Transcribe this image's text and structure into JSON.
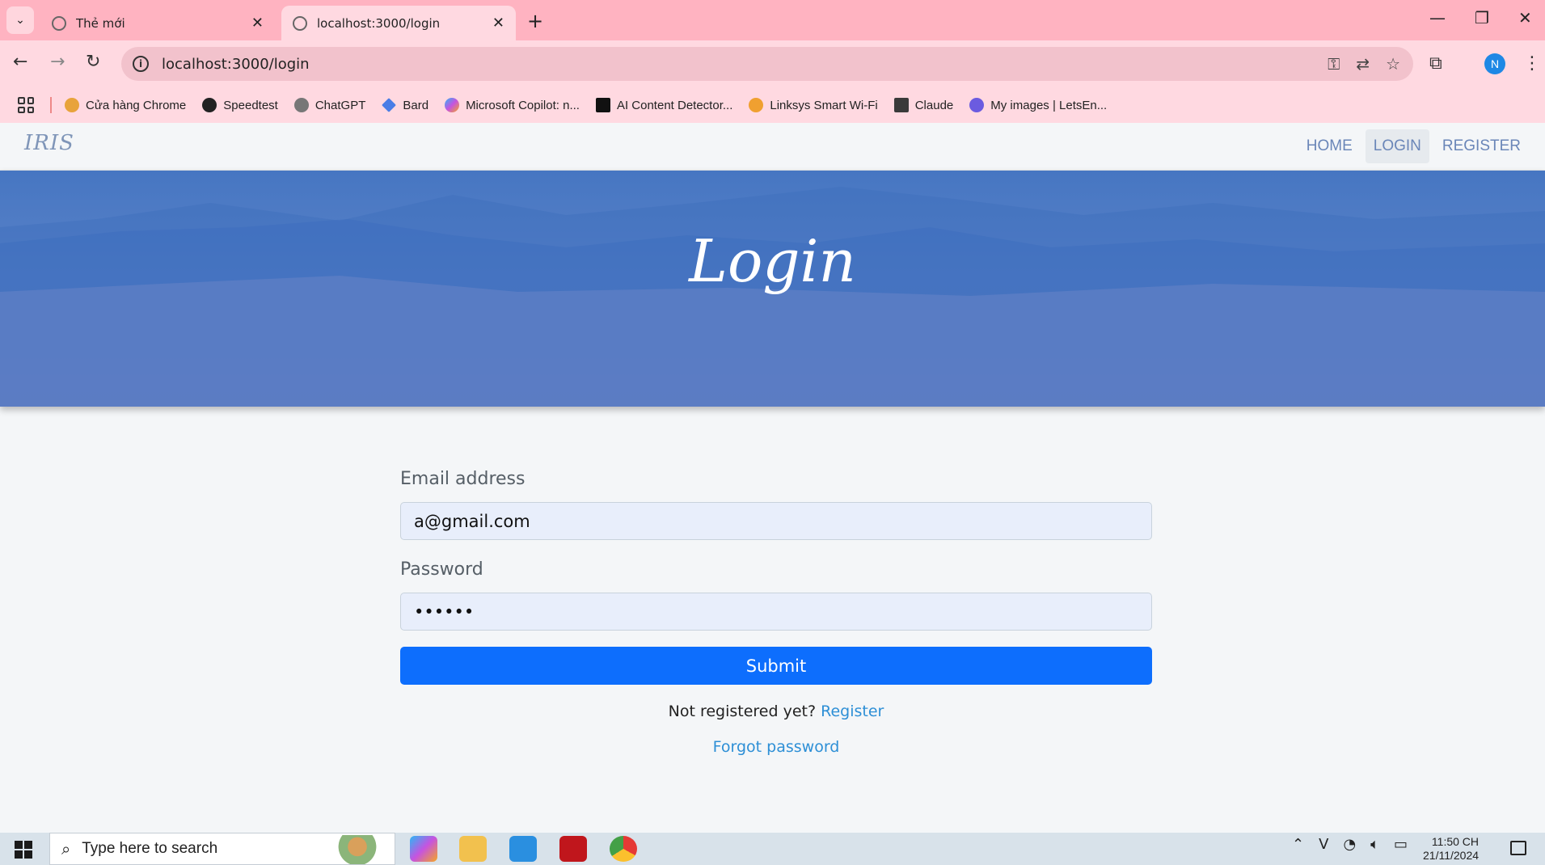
{
  "browser": {
    "tabs": [
      {
        "title": "Thẻ mới",
        "close": "✕"
      },
      {
        "title": "localhost:3000/login",
        "close": "✕"
      }
    ],
    "new_tab": "+",
    "url": "localhost:3000/login",
    "avatar_initial": "N",
    "bookmarks": [
      {
        "label": "Cửa hàng Chrome",
        "color": "#e8a33b"
      },
      {
        "label": "Speedtest",
        "color": "#222222"
      },
      {
        "label": "ChatGPT",
        "color": "#555555"
      },
      {
        "label": "Bard",
        "color": "#4a7de6"
      },
      {
        "label": "Microsoft Copilot: n...",
        "color": "#7b6be0"
      },
      {
        "label": "AI Content Detector...",
        "color": "#111111"
      },
      {
        "label": "Linksys Smart Wi-Fi",
        "color": "#f0a030"
      },
      {
        "label": "Claude",
        "color": "#3a3a3a"
      },
      {
        "label": "My images | LetsEn...",
        "color": "#6b5be0"
      }
    ]
  },
  "site": {
    "brand": "IRIS",
    "nav": [
      "HOME",
      "LOGIN",
      "REGISTER"
    ],
    "hero_title": "Login"
  },
  "form": {
    "email_label": "Email address",
    "email_value": "a@gmail.com",
    "password_label": "Password",
    "password_value": "••••••",
    "submit_label": "Submit",
    "not_registered": "Not registered yet?",
    "register_link": "Register",
    "forgot_link": "Forgot password"
  },
  "taskbar": {
    "search_placeholder": "Type here to search",
    "time": "11:50 CH",
    "date": "21/11/2024"
  },
  "colors": {
    "accent": "#0d6efd",
    "hero": "#4f78c4",
    "tab_strip": "#ffb3c1",
    "link": "#2d8fd6"
  }
}
